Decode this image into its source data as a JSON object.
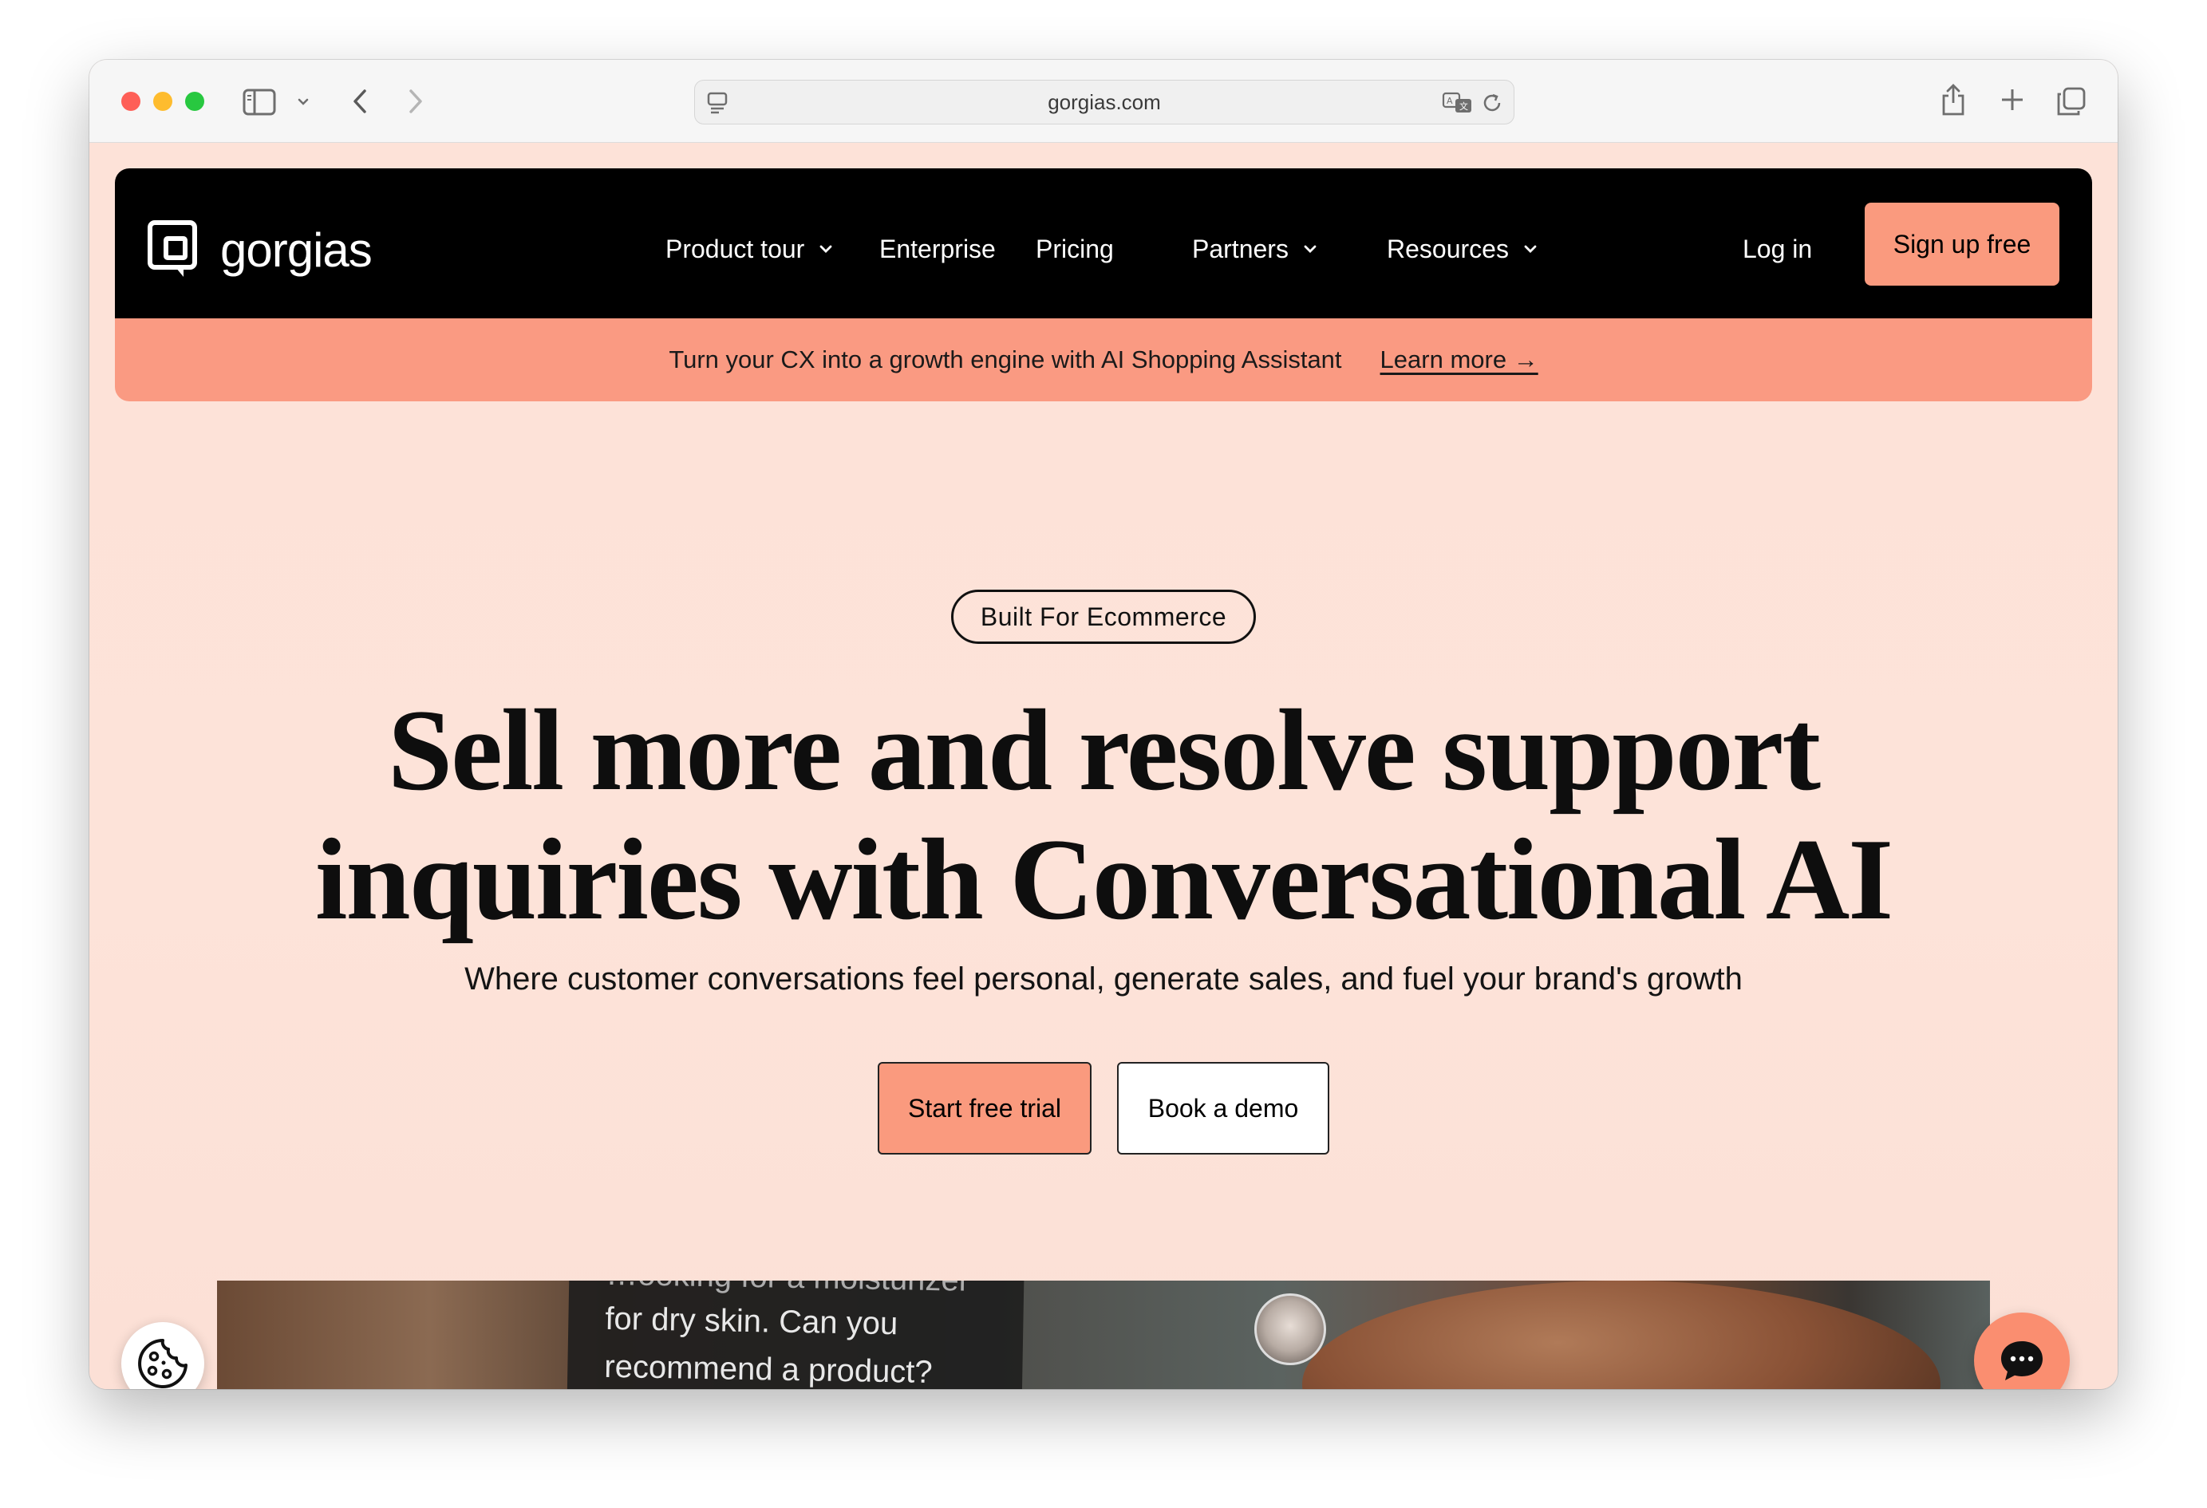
{
  "browser": {
    "url": "gorgias.com",
    "icons": [
      "sidebar-icon",
      "chevron-down-icon",
      "back-icon",
      "forward-icon",
      "page-settings-icon",
      "translate-icon",
      "reload-icon",
      "share-icon",
      "plus-icon",
      "tabs-icon"
    ]
  },
  "header": {
    "logo_text": "gorgias",
    "nav": [
      {
        "label": "Product tour",
        "has_dropdown": true
      },
      {
        "label": "Enterprise",
        "has_dropdown": false
      },
      {
        "label": "Pricing",
        "has_dropdown": false
      },
      {
        "label": "Partners",
        "has_dropdown": true
      },
      {
        "label": "Resources",
        "has_dropdown": true
      }
    ],
    "login_label": "Log in",
    "signup_label": "Sign up free"
  },
  "announcement": {
    "message": "Turn your CX into a growth engine with AI Shopping Assistant",
    "link_label": "Learn more →"
  },
  "hero": {
    "badge": "Built For Ecommerce",
    "title_line1": "Sell more and resolve support",
    "title_line2": "inquiries with Conversational AI",
    "subtitle": "Where customer conversations feel personal, generate sales, and fuel your brand's growth",
    "primary_cta": "Start free trial",
    "secondary_cta": "Book a demo"
  },
  "media": {
    "chat_faded": "…ooking for a moisturizer",
    "chat_line1": "for dry skin. Can you",
    "chat_line2": "recommend a product?"
  },
  "colors": {
    "accent": "#fa9a7e",
    "nav_bg": "#000000",
    "page_bg": "#fde2d8",
    "announcement_bg": "#fa9a82"
  }
}
